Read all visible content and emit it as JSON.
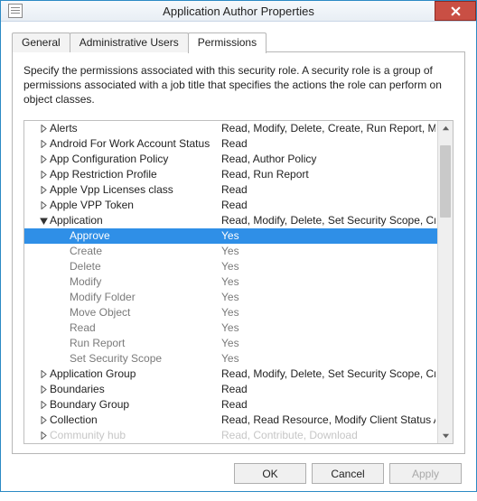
{
  "window": {
    "title": "Application Author Properties"
  },
  "tabs": [
    {
      "label": "General",
      "active": false
    },
    {
      "label": "Administrative Users",
      "active": false
    },
    {
      "label": "Permissions",
      "active": true
    }
  ],
  "description": "Specify the permissions associated with this security role. A security role is a group of permissions associated with a job title that specifies the actions the role can perform on object classes.",
  "tree": [
    {
      "type": "parent",
      "expanded": false,
      "name": "Alerts",
      "perm": "Read, Modify, Delete, Create, Run Report, M"
    },
    {
      "type": "parent",
      "expanded": false,
      "name": "Android For Work Account Status",
      "perm": "Read"
    },
    {
      "type": "parent",
      "expanded": false,
      "name": "App Configuration Policy",
      "perm": "Read, Author Policy"
    },
    {
      "type": "parent",
      "expanded": false,
      "name": "App Restriction Profile",
      "perm": "Read, Run Report"
    },
    {
      "type": "parent",
      "expanded": false,
      "name": "Apple Vpp Licenses class",
      "perm": "Read"
    },
    {
      "type": "parent",
      "expanded": false,
      "name": "Apple VPP Token",
      "perm": "Read"
    },
    {
      "type": "parent",
      "expanded": true,
      "name": "Application",
      "perm": "Read, Modify, Delete, Set Security Scope, Cr"
    },
    {
      "type": "child",
      "selected": true,
      "name": "Approve",
      "perm": "Yes"
    },
    {
      "type": "child",
      "name": "Create",
      "perm": "Yes"
    },
    {
      "type": "child",
      "name": "Delete",
      "perm": "Yes"
    },
    {
      "type": "child",
      "name": "Modify",
      "perm": "Yes"
    },
    {
      "type": "child",
      "name": "Modify Folder",
      "perm": "Yes"
    },
    {
      "type": "child",
      "name": "Move Object",
      "perm": "Yes"
    },
    {
      "type": "child",
      "name": "Read",
      "perm": "Yes"
    },
    {
      "type": "child",
      "name": "Run Report",
      "perm": "Yes"
    },
    {
      "type": "child",
      "name": "Set Security Scope",
      "perm": "Yes"
    },
    {
      "type": "parent",
      "expanded": false,
      "name": "Application Group",
      "perm": "Read, Modify, Delete, Set Security Scope, Cr"
    },
    {
      "type": "parent",
      "expanded": false,
      "name": "Boundaries",
      "perm": "Read"
    },
    {
      "type": "parent",
      "expanded": false,
      "name": "Boundary Group",
      "perm": "Read"
    },
    {
      "type": "parent",
      "expanded": false,
      "name": "Collection",
      "perm": "Read, Read Resource, Modify Client Status A"
    },
    {
      "type": "parent",
      "expanded": false,
      "cut": true,
      "name": "Community hub",
      "perm": "Read, Contribute, Download"
    }
  ],
  "buttons": {
    "ok": "OK",
    "cancel": "Cancel",
    "apply": "Apply"
  }
}
